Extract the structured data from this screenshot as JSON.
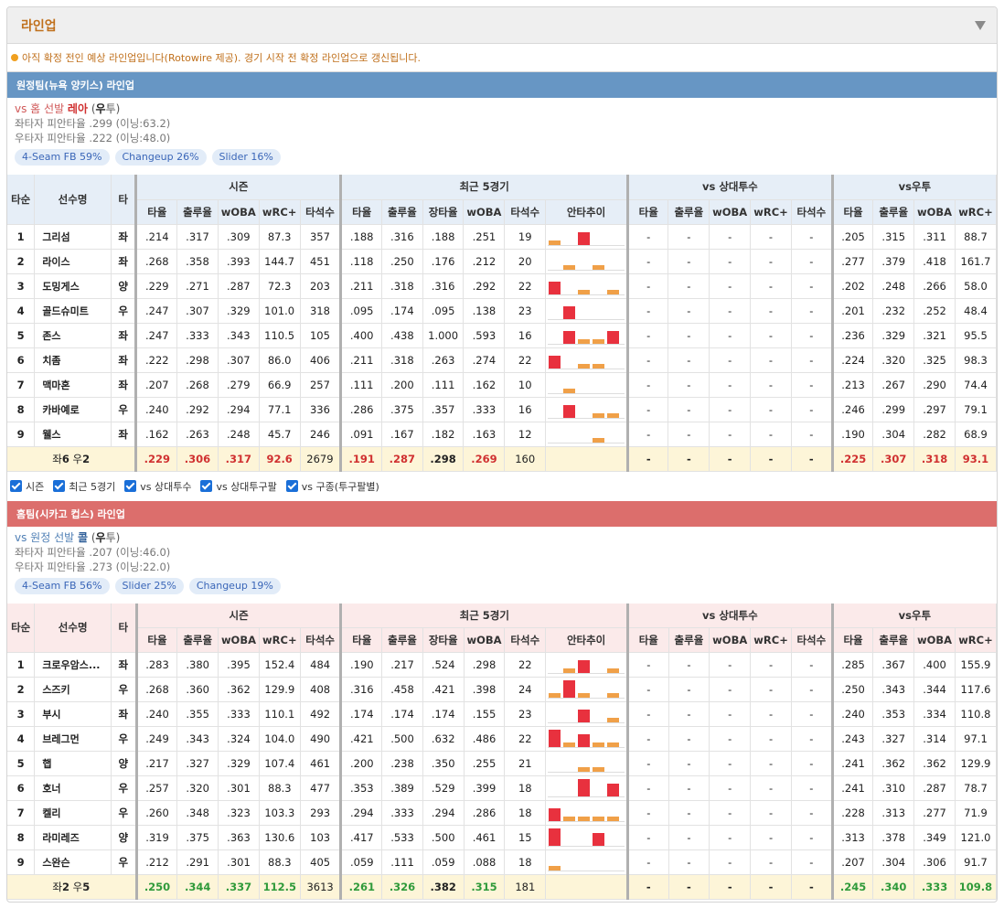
{
  "header": {
    "title": "라인업"
  },
  "notice": "아직 확정 전인 예상 라인업입니다(Rotowire 제공). 경기 시작 전 확정 라인업으로 갱신됩니다.",
  "columns": {
    "order": "타순",
    "name": "선수명",
    "hand": "타",
    "groups": [
      "시즌",
      "최근 5경기",
      "vs 상대투수",
      "vs우투"
    ],
    "season": [
      "타율",
      "출루율",
      "wOBA",
      "wRC+",
      "타석수"
    ],
    "recent": [
      "타율",
      "출루율",
      "장타율",
      "wOBA",
      "타석수",
      "안타추이"
    ],
    "vsp": [
      "타율",
      "출루율",
      "wOBA",
      "wRC+",
      "타석수"
    ],
    "vsh": [
      "타율",
      "출루율",
      "wOBA",
      "wRC+"
    ]
  },
  "colors": {
    "spark_red": "#e8313e",
    "spark_orange": "#f0a048",
    "away_bar": "#6796c4",
    "home_bar": "#dc6e6c"
  },
  "filters": [
    "시즌",
    "최근 5경기",
    "vs 상대투수",
    "vs 상대투구팔",
    "vs 구종(투구팔별)"
  ],
  "away": {
    "title": "원정팀(뉴욕 양키스) 라인업",
    "vs_prefix": "vs 홈 선발 ",
    "pitcher": "레아",
    "hand_open": " (",
    "hand": "우",
    "hand_rest": "투)",
    "lhb_line": "좌타자 피안타율 .299 (이닝:63.2)",
    "rhb_line": "우타자 피안타율 .222 (이닝:48.0)",
    "pitches": [
      "4-Seam FB 59%",
      "Changeup 26%",
      "Slider 16%"
    ],
    "rows": [
      {
        "order": "1",
        "name": "그리섬",
        "hand": "좌",
        "season": [
          ".214",
          ".317",
          ".309",
          "87.3",
          "357"
        ],
        "recent": [
          ".188",
          ".316",
          ".188",
          ".251",
          "19"
        ],
        "spark": [
          1,
          0,
          2,
          0,
          0
        ],
        "vsp": [
          "-",
          "-",
          "-",
          "-",
          "-"
        ],
        "vsh": [
          ".205",
          ".315",
          ".311",
          "88.7"
        ]
      },
      {
        "order": "2",
        "name": "라이스",
        "hand": "좌",
        "season": [
          ".268",
          ".358",
          ".393",
          "144.7",
          "451"
        ],
        "recent": [
          ".118",
          ".250",
          ".176",
          ".212",
          "20"
        ],
        "spark": [
          0,
          1,
          0,
          1,
          0
        ],
        "vsp": [
          "-",
          "-",
          "-",
          "-",
          "-"
        ],
        "vsh": [
          ".277",
          ".379",
          ".418",
          "161.7"
        ]
      },
      {
        "order": "3",
        "name": "도밍게스",
        "hand": "양",
        "season": [
          ".229",
          ".271",
          ".287",
          "72.3",
          "203"
        ],
        "recent": [
          ".211",
          ".318",
          ".316",
          ".292",
          "22"
        ],
        "spark": [
          2,
          0,
          1,
          0,
          1
        ],
        "vsp": [
          "-",
          "-",
          "-",
          "-",
          "-"
        ],
        "vsh": [
          ".202",
          ".248",
          ".266",
          "58.0"
        ]
      },
      {
        "order": "4",
        "name": "골드슈미트",
        "hand": "우",
        "season": [
          ".247",
          ".307",
          ".329",
          "101.0",
          "318"
        ],
        "recent": [
          ".095",
          ".174",
          ".095",
          ".138",
          "23"
        ],
        "spark": [
          0,
          2,
          0,
          0,
          0
        ],
        "vsp": [
          "-",
          "-",
          "-",
          "-",
          "-"
        ],
        "vsh": [
          ".201",
          ".232",
          ".252",
          "48.4"
        ]
      },
      {
        "order": "5",
        "name": "존스",
        "hand": "좌",
        "season": [
          ".247",
          ".333",
          ".343",
          "110.5",
          "105"
        ],
        "recent": [
          ".400",
          ".438",
          "1.000",
          ".593",
          "16"
        ],
        "spark": [
          0,
          2,
          1,
          1,
          2
        ],
        "vsp": [
          "-",
          "-",
          "-",
          "-",
          "-"
        ],
        "vsh": [
          ".236",
          ".329",
          ".321",
          "95.5"
        ]
      },
      {
        "order": "6",
        "name": "치좀",
        "hand": "좌",
        "season": [
          ".222",
          ".298",
          ".307",
          "86.0",
          "406"
        ],
        "recent": [
          ".211",
          ".318",
          ".263",
          ".274",
          "22"
        ],
        "spark": [
          2,
          0,
          1,
          1,
          0
        ],
        "vsp": [
          "-",
          "-",
          "-",
          "-",
          "-"
        ],
        "vsh": [
          ".224",
          ".320",
          ".325",
          "98.3"
        ]
      },
      {
        "order": "7",
        "name": "맥마혼",
        "hand": "좌",
        "season": [
          ".207",
          ".268",
          ".279",
          "66.9",
          "257"
        ],
        "recent": [
          ".111",
          ".200",
          ".111",
          ".162",
          "10"
        ],
        "spark": [
          0,
          1,
          0,
          0,
          0
        ],
        "vsp": [
          "-",
          "-",
          "-",
          "-",
          "-"
        ],
        "vsh": [
          ".213",
          ".267",
          ".290",
          "74.4"
        ]
      },
      {
        "order": "8",
        "name": "카바예로",
        "hand": "우",
        "season": [
          ".240",
          ".292",
          ".294",
          "77.1",
          "336"
        ],
        "recent": [
          ".286",
          ".375",
          ".357",
          ".333",
          "16"
        ],
        "spark": [
          0,
          2,
          0,
          1,
          1
        ],
        "vsp": [
          "-",
          "-",
          "-",
          "-",
          "-"
        ],
        "vsh": [
          ".246",
          ".299",
          ".297",
          "79.1"
        ]
      },
      {
        "order": "9",
        "name": "웰스",
        "hand": "좌",
        "season": [
          ".162",
          ".263",
          ".248",
          "45.7",
          "246"
        ],
        "recent": [
          ".091",
          ".167",
          ".182",
          ".163",
          "12"
        ],
        "spark": [
          0,
          0,
          0,
          1,
          0
        ],
        "vsp": [
          "-",
          "-",
          "-",
          "-",
          "-"
        ],
        "vsh": [
          ".190",
          ".304",
          ".282",
          "68.9"
        ]
      }
    ],
    "total": {
      "label_pre": "좌",
      "left": "6",
      "label_mid": " 우",
      "right": "2",
      "season": [
        ".229",
        ".306",
        ".317",
        "92.6",
        "2679"
      ],
      "recent": [
        ".191",
        ".287",
        ".298",
        ".269",
        "160"
      ],
      "vsp": [
        "-",
        "-",
        "-",
        "-",
        "-"
      ],
      "vsh": [
        ".225",
        ".307",
        ".318",
        "93.1"
      ]
    }
  },
  "home": {
    "title": "홈팀(시카고 컵스) 라인업",
    "vs_prefix": "vs 원정 선발 ",
    "pitcher": "콜",
    "hand_open": " (",
    "hand": "우",
    "hand_rest": "투)",
    "lhb_line": "좌타자 피안타율 .207 (이닝:46.0)",
    "rhb_line": "우타자 피안타율 .273 (이닝:22.0)",
    "pitches": [
      "4-Seam FB 56%",
      "Slider 25%",
      "Changeup 19%"
    ],
    "rows": [
      {
        "order": "1",
        "name": "크로우암스...",
        "hand": "좌",
        "season": [
          ".283",
          ".380",
          ".395",
          "152.4",
          "484"
        ],
        "recent": [
          ".190",
          ".217",
          ".524",
          ".298",
          "22"
        ],
        "spark": [
          0,
          1,
          2,
          0,
          1
        ],
        "vsp": [
          "-",
          "-",
          "-",
          "-",
          "-"
        ],
        "vsh": [
          ".285",
          ".367",
          ".400",
          "155.9"
        ]
      },
      {
        "order": "2",
        "name": "스즈키",
        "hand": "우",
        "season": [
          ".268",
          ".360",
          ".362",
          "129.9",
          "408"
        ],
        "recent": [
          ".316",
          ".458",
          ".421",
          ".398",
          "24"
        ],
        "spark": [
          1,
          3,
          1,
          0,
          1
        ],
        "vsp": [
          "-",
          "-",
          "-",
          "-",
          "-"
        ],
        "vsh": [
          ".250",
          ".343",
          ".344",
          "117.6"
        ]
      },
      {
        "order": "3",
        "name": "부시",
        "hand": "좌",
        "season": [
          ".240",
          ".355",
          ".333",
          "110.1",
          "492"
        ],
        "recent": [
          ".174",
          ".174",
          ".174",
          ".155",
          "23"
        ],
        "spark": [
          0,
          0,
          2,
          0,
          1
        ],
        "vsp": [
          "-",
          "-",
          "-",
          "-",
          "-"
        ],
        "vsh": [
          ".240",
          ".353",
          ".334",
          "110.8"
        ]
      },
      {
        "order": "4",
        "name": "브레그먼",
        "hand": "우",
        "season": [
          ".249",
          ".343",
          ".324",
          "104.0",
          "490"
        ],
        "recent": [
          ".421",
          ".500",
          ".632",
          ".486",
          "22"
        ],
        "spark": [
          3,
          1,
          2,
          1,
          1
        ],
        "vsp": [
          "-",
          "-",
          "-",
          "-",
          "-"
        ],
        "vsh": [
          ".243",
          ".327",
          ".314",
          "97.1"
        ]
      },
      {
        "order": "5",
        "name": "햅",
        "hand": "양",
        "season": [
          ".217",
          ".327",
          ".329",
          "107.4",
          "461"
        ],
        "recent": [
          ".200",
          ".238",
          ".350",
          ".255",
          "21"
        ],
        "spark": [
          0,
          0,
          1,
          1,
          0
        ],
        "vsp": [
          "-",
          "-",
          "-",
          "-",
          "-"
        ],
        "vsh": [
          ".241",
          ".362",
          ".362",
          "129.9"
        ]
      },
      {
        "order": "6",
        "name": "호너",
        "hand": "우",
        "season": [
          ".257",
          ".320",
          ".301",
          "88.3",
          "477"
        ],
        "recent": [
          ".353",
          ".389",
          ".529",
          ".399",
          "18"
        ],
        "spark": [
          0,
          0,
          3,
          0,
          2
        ],
        "vsp": [
          "-",
          "-",
          "-",
          "-",
          "-"
        ],
        "vsh": [
          ".241",
          ".310",
          ".287",
          "78.7"
        ]
      },
      {
        "order": "7",
        "name": "켈리",
        "hand": "우",
        "season": [
          ".260",
          ".348",
          ".323",
          "103.3",
          "293"
        ],
        "recent": [
          ".294",
          ".333",
          ".294",
          ".286",
          "18"
        ],
        "spark": [
          2,
          1,
          1,
          1,
          1
        ],
        "vsp": [
          "-",
          "-",
          "-",
          "-",
          "-"
        ],
        "vsh": [
          ".228",
          ".313",
          ".277",
          "71.9"
        ]
      },
      {
        "order": "8",
        "name": "라미레즈",
        "hand": "양",
        "season": [
          ".319",
          ".375",
          ".363",
          "130.6",
          "103"
        ],
        "recent": [
          ".417",
          ".533",
          ".500",
          ".461",
          "15"
        ],
        "spark": [
          3,
          0,
          0,
          2,
          0
        ],
        "vsp": [
          "-",
          "-",
          "-",
          "-",
          "-"
        ],
        "vsh": [
          ".313",
          ".378",
          ".349",
          "121.0"
        ]
      },
      {
        "order": "9",
        "name": "스완슨",
        "hand": "우",
        "season": [
          ".212",
          ".291",
          ".301",
          "88.3",
          "405"
        ],
        "recent": [
          ".059",
          ".111",
          ".059",
          ".088",
          "18"
        ],
        "spark": [
          1,
          0,
          0,
          0,
          0
        ],
        "vsp": [
          "-",
          "-",
          "-",
          "-",
          "-"
        ],
        "vsh": [
          ".207",
          ".304",
          ".306",
          "91.7"
        ]
      }
    ],
    "total": {
      "label_pre": "좌",
      "left": "2",
      "label_mid": " 우",
      "right": "5",
      "season": [
        ".250",
        ".344",
        ".337",
        "112.5",
        "3613"
      ],
      "recent": [
        ".261",
        ".326",
        ".382",
        ".315",
        "181"
      ],
      "vsp": [
        "-",
        "-",
        "-",
        "-",
        "-"
      ],
      "vsh": [
        ".245",
        ".340",
        ".333",
        "109.8"
      ]
    }
  }
}
